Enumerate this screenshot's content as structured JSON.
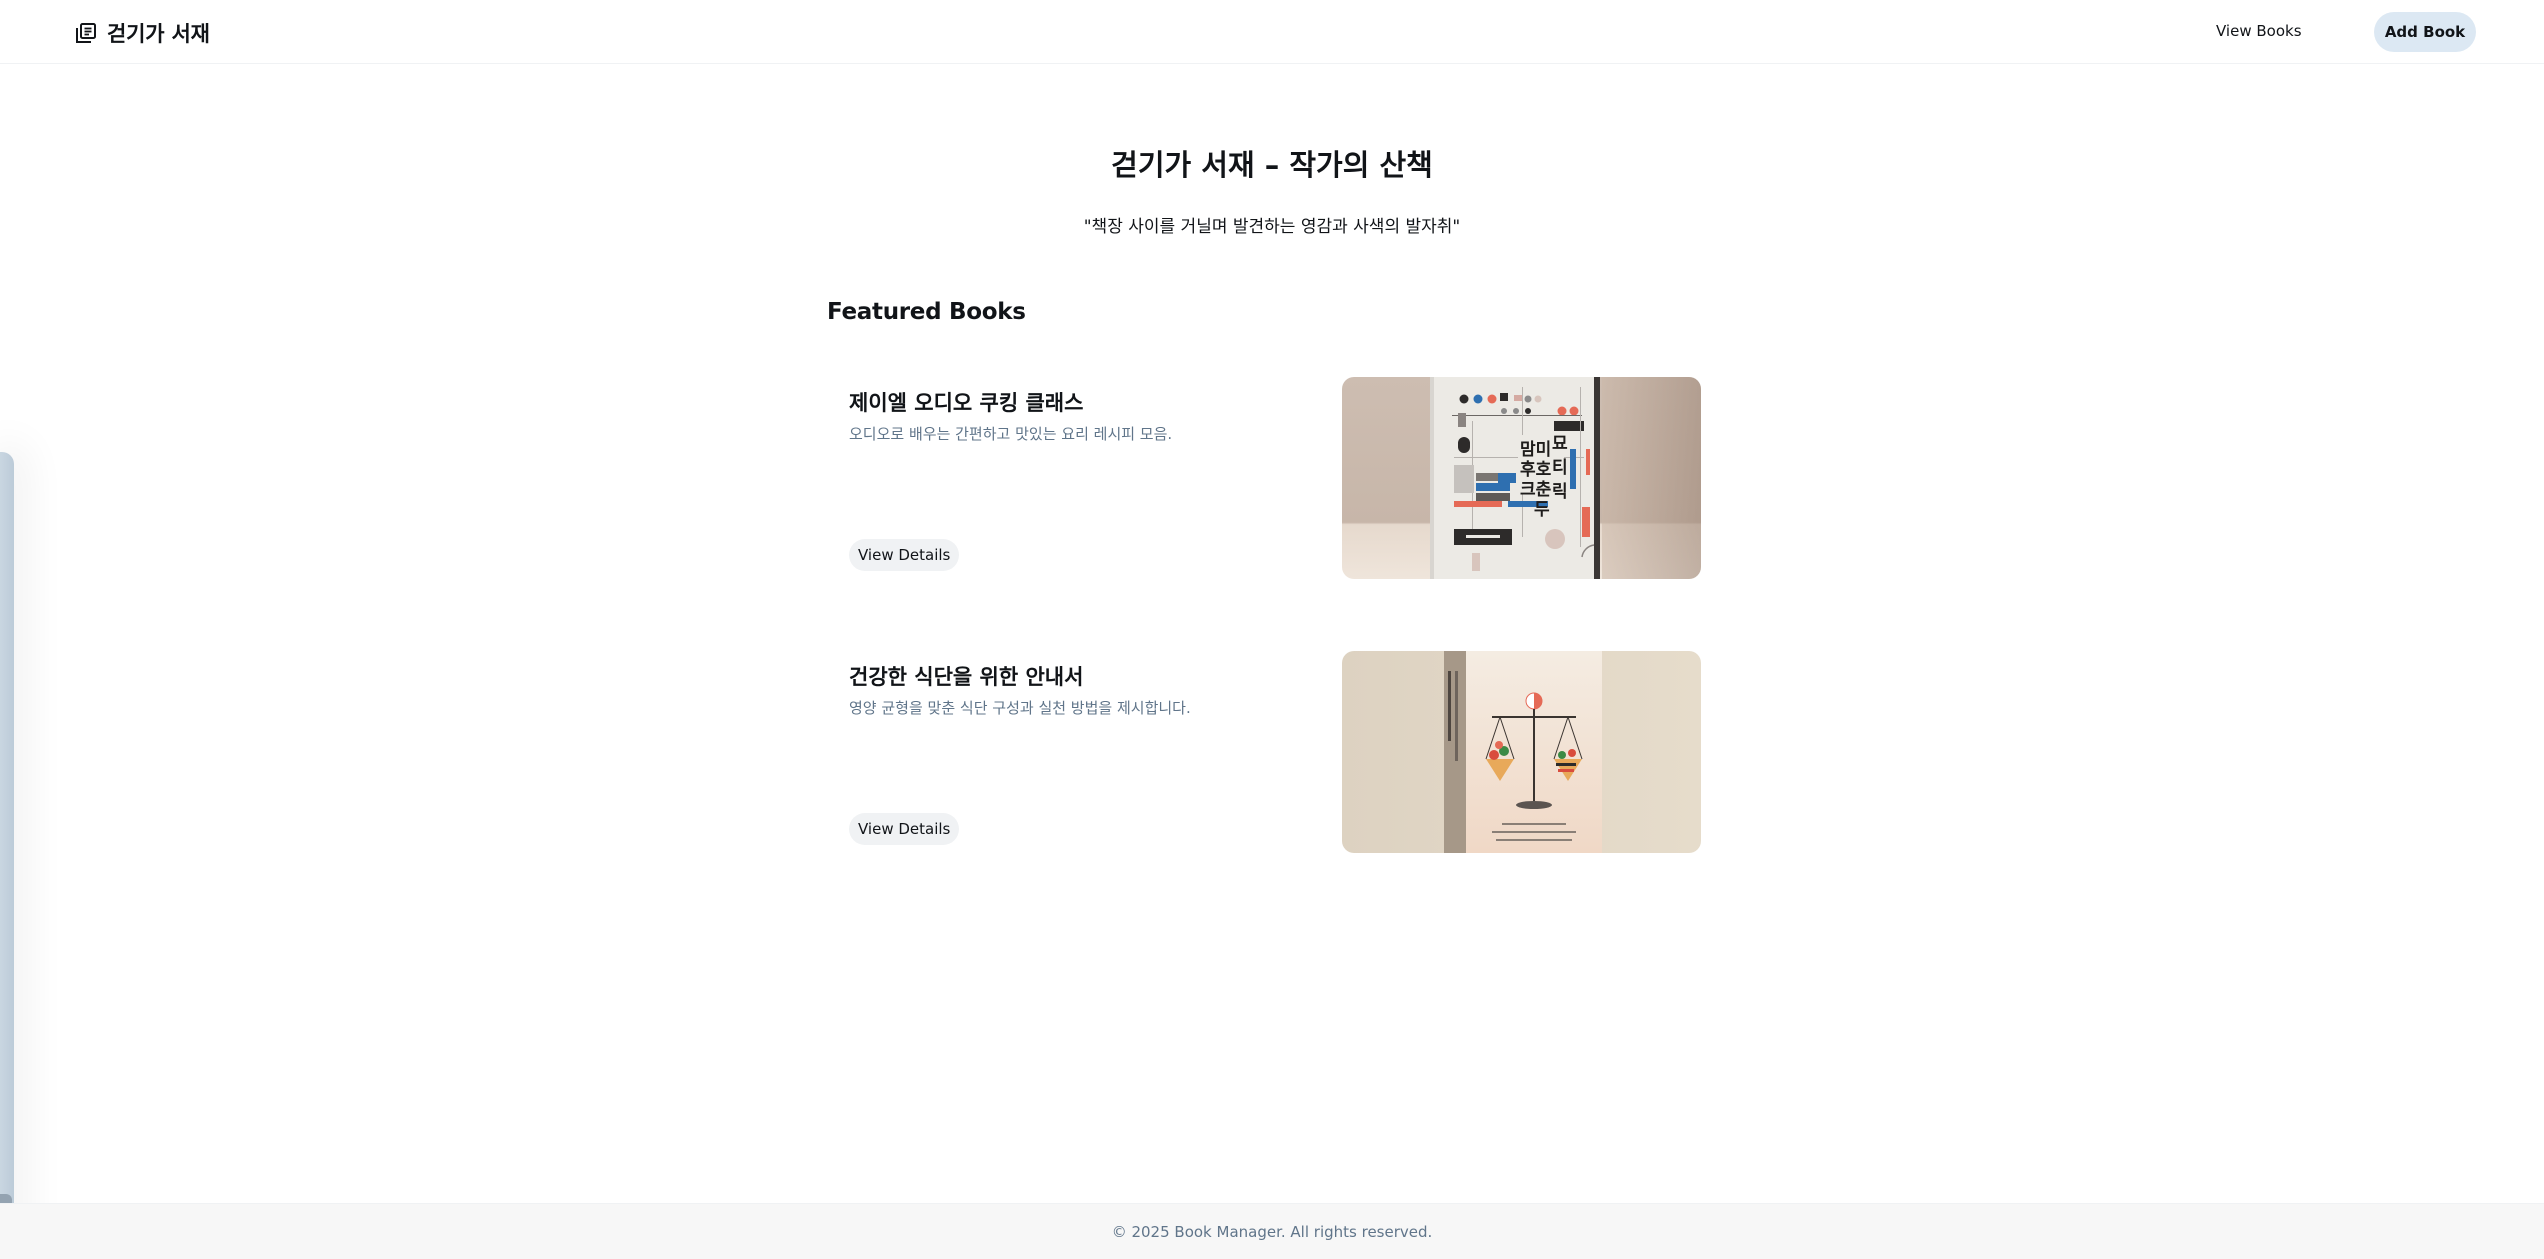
{
  "header": {
    "brand_name": "걷기가 서재",
    "brand_icon": "library-books-icon",
    "nav_view_books": "View Books",
    "add_book_label": "Add Book"
  },
  "hero": {
    "title": "걷기가 서재 – 작가의 산책",
    "quote": "\"책장 사이를 거닐며 발견하는 영감과 사색의 발자취\""
  },
  "featured": {
    "section_title": "Featured Books",
    "books": [
      {
        "title": "제이엘 오디오 쿠킹 클래스",
        "description": "오디오로 배우는 간편하고 맛있는 요리 레시피 모음.",
        "button_label": "View Details"
      },
      {
        "title": "건강한 식단을 위한 안내서",
        "description": "영양 균형을 맞춘 식단 구성과 실천 방법을 제시합니다.",
        "button_label": "View Details"
      }
    ]
  },
  "footer": {
    "copyright": "© 2025 Book Manager. All rights reserved."
  },
  "colors": {
    "accent_button": "#dce8f3",
    "secondary_text": "#60758a",
    "button_bg": "#f0f2f4"
  }
}
